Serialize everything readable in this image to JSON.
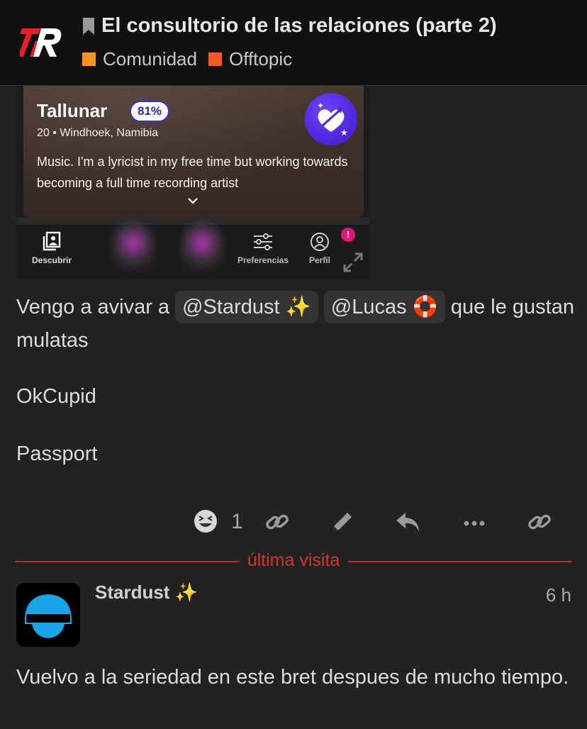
{
  "header": {
    "title": "El consultorio de las relaciones (parte 2)",
    "categories": [
      {
        "name": "Comunidad",
        "color": "#f7941d"
      },
      {
        "name": "Offtopic",
        "color": "#f15a24"
      }
    ],
    "logo_icon": "site-logo-icon",
    "bookmark_icon": "bookmark-icon"
  },
  "embed": {
    "profile_name": "Tallunar",
    "match_percent": "81%",
    "location": "20 • Windhoek, Namibia",
    "bio": "Music. I'm a lyricist in my free time but working towards becoming a full time recording artist",
    "tabs": {
      "discover": "Descubrir",
      "preferences": "Preferencias",
      "profile": "Perfil"
    },
    "notif_badge": "!"
  },
  "post": {
    "line1_pre": "Vengo a avivar a",
    "mention1": "@Stardust ✨",
    "mention2": "@Lucas 🛟",
    "line1_post": "que le gustan mulatas",
    "p2": "OkCupid",
    "p3": "Passport",
    "like_count": "1"
  },
  "divider": {
    "label": "última visita"
  },
  "reply": {
    "author": "Stardust ✨",
    "time": "6 h",
    "body": "Vuelvo a la seriedad en este bret despues de mucho tiempo."
  },
  "colors": {
    "background": "#222222",
    "header_bg": "#111111",
    "accent_red": "#d23434",
    "avatar_blue": "#1aa3e8"
  }
}
